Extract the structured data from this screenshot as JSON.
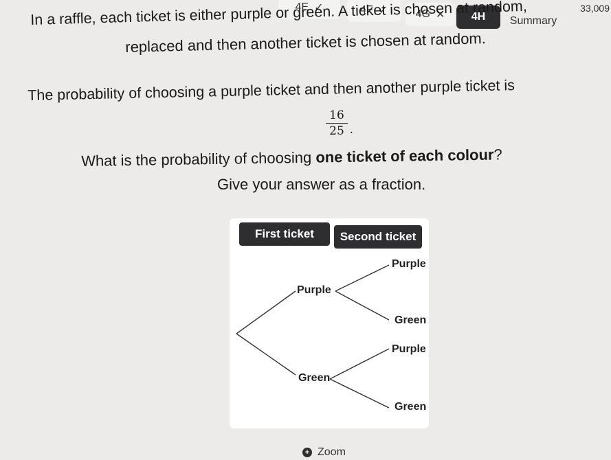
{
  "tabs": [
    {
      "label": "4E",
      "status": "correct"
    },
    {
      "label": "4F",
      "status": "correct"
    },
    {
      "label": "4G",
      "status": "incorrect"
    },
    {
      "label": "4H",
      "status": "active"
    },
    {
      "label": "Summary",
      "status": "none"
    }
  ],
  "tick_glyph": "✓",
  "cross_glyph": "✕",
  "score": "33,009",
  "question": {
    "line1": "In a raffle, each ticket is either purple or green. A ticket is chosen at random,",
    "line2": "replaced and then another ticket is chosen at random.",
    "line3": "The probability of choosing a purple ticket and then another purple ticket is",
    "fraction": {
      "numerator": "16",
      "denominator": "25"
    },
    "line4_prefix": "What is the probability of choosing ",
    "line4_bold": "one ticket of each colour",
    "line4_suffix": "?",
    "line5": "Give your answer as a fraction."
  },
  "tree": {
    "header_first": "First ticket",
    "header_second": "Second ticket",
    "first_purple": "Purple",
    "first_green": "Green",
    "second_purple_1": "Purple",
    "second_green_1": "Green",
    "second_purple_2": "Purple",
    "second_green_2": "Green"
  },
  "zoom_label": "Zoom",
  "zoom_icon": "+",
  "colors": {
    "dark": "#2e2e30",
    "background": "#ecebe9",
    "card": "#ffffff"
  }
}
